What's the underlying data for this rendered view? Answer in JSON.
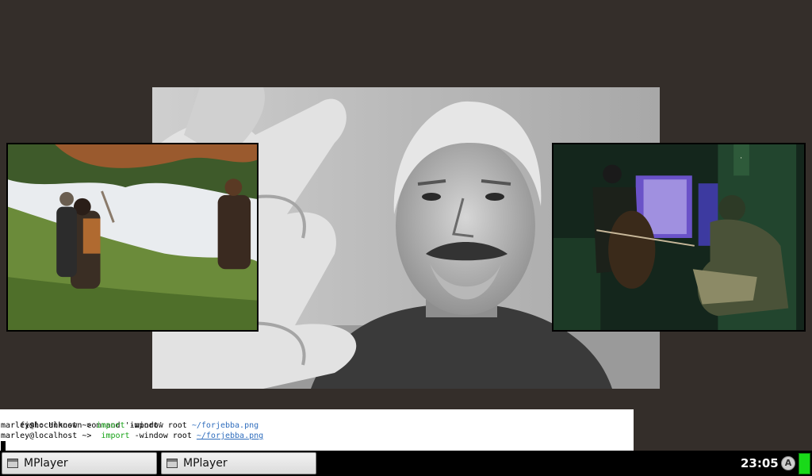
{
  "terminal": {
    "lines": [
      {
        "text": "fish: Unknown command 'import'"
      },
      {
        "prompt": "marley@localhost ~> ",
        "command": "import",
        "args": " -window root ",
        "path": "~/forjebba.png"
      },
      {
        "prompt": "marley@localhost ~> ",
        "command": " import",
        "args": " -window root ",
        "path": "~/forjebba.png"
      }
    ]
  },
  "taskbar": {
    "tasks": [
      {
        "label": "MPlayer",
        "icon": "window-icon"
      },
      {
        "label": "MPlayer",
        "icon": "window-icon"
      }
    ],
    "clock": "23:05",
    "user_badge": "A"
  },
  "colors": {
    "desktop": "#342e2a",
    "command": "#17a317",
    "path": "#2f6dbd",
    "battery": "#19d919"
  }
}
